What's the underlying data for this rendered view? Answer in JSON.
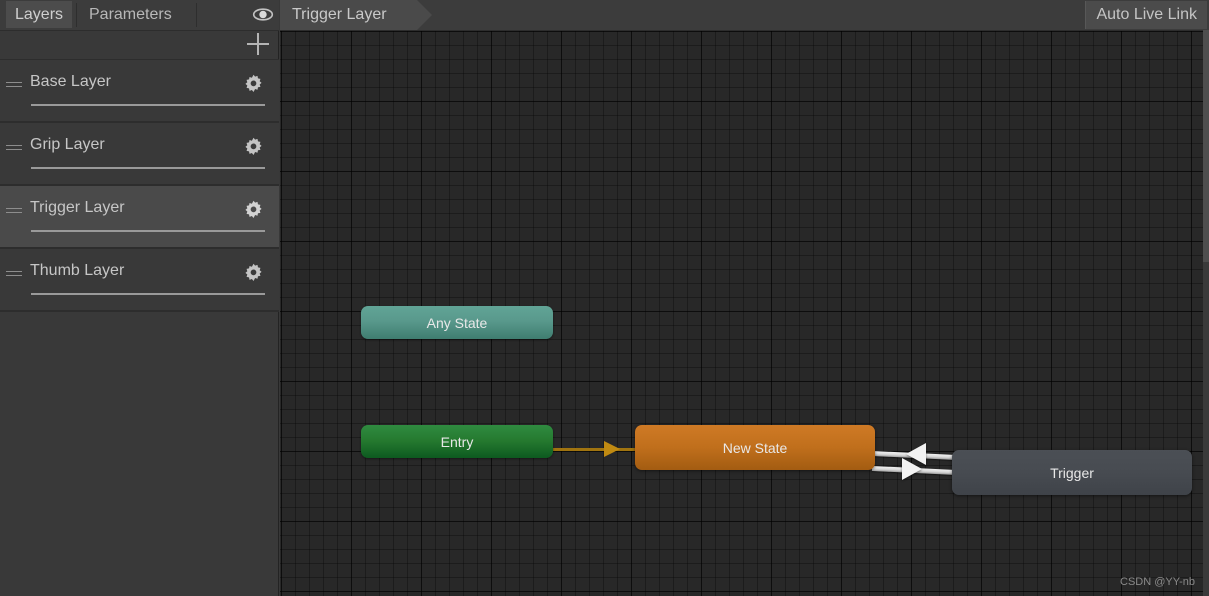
{
  "sidebar": {
    "tabs": [
      {
        "label": "Layers",
        "active": true
      },
      {
        "label": "Parameters",
        "active": false
      }
    ],
    "visibility_icon": "eye-icon",
    "add_button_icon": "plus-icon",
    "layers": [
      {
        "label": "Base Layer",
        "selected": false,
        "settings_icon": "gear-icon",
        "weight_slider": 100
      },
      {
        "label": "Grip Layer",
        "selected": false,
        "settings_icon": "gear-icon",
        "weight_slider": 100
      },
      {
        "label": "Trigger Layer",
        "selected": true,
        "settings_icon": "gear-icon",
        "weight_slider": 100
      },
      {
        "label": "Thumb Layer",
        "selected": false,
        "settings_icon": "gear-icon",
        "weight_slider": 100
      }
    ]
  },
  "graph": {
    "breadcrumb": "Trigger Layer",
    "auto_live_link_label": "Auto Live Link",
    "nodes": [
      {
        "id": "any-state",
        "label": "Any State",
        "color": "#4f9387"
      },
      {
        "id": "entry",
        "label": "Entry",
        "color": "#1f7a2e"
      },
      {
        "id": "new-state",
        "label": "New State",
        "color": "#c06f1c"
      },
      {
        "id": "trigger",
        "label": "Trigger",
        "color": "#474b51"
      }
    ],
    "transitions": [
      {
        "from": "entry",
        "to": "new-state",
        "color": "#a07410",
        "direction": "right"
      },
      {
        "from": "trigger",
        "to": "new-state",
        "color": "#e8e8e8",
        "direction": "left"
      },
      {
        "from": "new-state",
        "to": "trigger",
        "color": "#e8e8e8",
        "direction": "right"
      }
    ]
  },
  "watermark": "CSDN @YY-nb"
}
